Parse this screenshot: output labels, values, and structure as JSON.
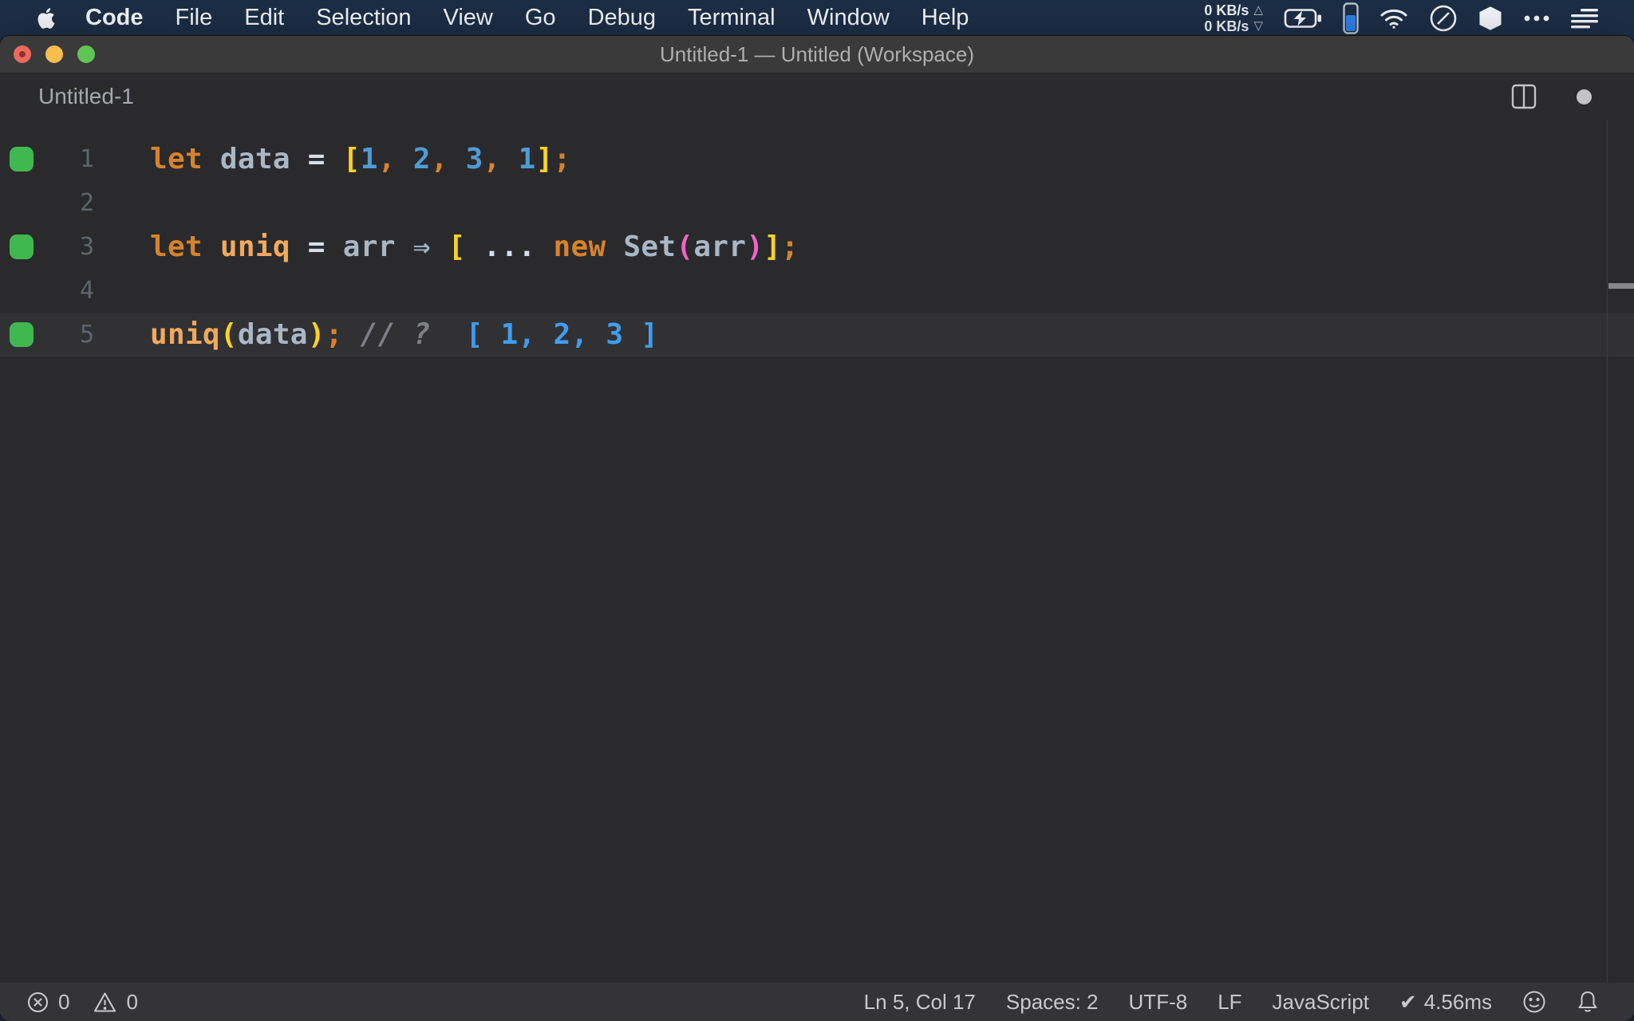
{
  "menubar": {
    "app_menu": "Code",
    "items": [
      "File",
      "Edit",
      "Selection",
      "View",
      "Go",
      "Debug",
      "Terminal",
      "Window",
      "Help"
    ],
    "network": {
      "up": "0 KB/s",
      "down": "0 KB/s"
    }
  },
  "titlebar": {
    "title": "Untitled-1 — Untitled (Workspace)"
  },
  "editor_header": {
    "tab_title": "Untitled-1"
  },
  "editor": {
    "current_line": 5,
    "lines": [
      {
        "num": 1,
        "marker": true,
        "tokens": [
          {
            "t": "let",
            "c": "keyword"
          },
          {
            "t": " ",
            "c": "plain"
          },
          {
            "t": "data",
            "c": "ident"
          },
          {
            "t": " ",
            "c": "plain"
          },
          {
            "t": "=",
            "c": "operator"
          },
          {
            "t": " ",
            "c": "plain"
          },
          {
            "t": "[",
            "c": "bracket1"
          },
          {
            "t": "1",
            "c": "number"
          },
          {
            "t": ",",
            "c": "punct"
          },
          {
            "t": " ",
            "c": "plain"
          },
          {
            "t": "2",
            "c": "number"
          },
          {
            "t": ",",
            "c": "punct"
          },
          {
            "t": " ",
            "c": "plain"
          },
          {
            "t": "3",
            "c": "number"
          },
          {
            "t": ",",
            "c": "punct"
          },
          {
            "t": " ",
            "c": "plain"
          },
          {
            "t": "1",
            "c": "number"
          },
          {
            "t": "]",
            "c": "bracket1"
          },
          {
            "t": ";",
            "c": "punct"
          }
        ]
      },
      {
        "num": 2,
        "marker": false,
        "tokens": []
      },
      {
        "num": 3,
        "marker": true,
        "tokens": [
          {
            "t": "let",
            "c": "keyword"
          },
          {
            "t": " ",
            "c": "plain"
          },
          {
            "t": "uniq",
            "c": "func"
          },
          {
            "t": " ",
            "c": "plain"
          },
          {
            "t": "=",
            "c": "operator"
          },
          {
            "t": " ",
            "c": "plain"
          },
          {
            "t": "arr",
            "c": "ident"
          },
          {
            "t": " ",
            "c": "plain"
          },
          {
            "t": "⇒",
            "c": "arrow"
          },
          {
            "t": " ",
            "c": "plain"
          },
          {
            "t": "[",
            "c": "bracket1"
          },
          {
            "t": " ",
            "c": "plain"
          },
          {
            "t": "... ",
            "c": "operator"
          },
          {
            "t": "new",
            "c": "keyword"
          },
          {
            "t": " ",
            "c": "plain"
          },
          {
            "t": "Set",
            "c": "ident"
          },
          {
            "t": "(",
            "c": "bracket2"
          },
          {
            "t": "arr",
            "c": "ident"
          },
          {
            "t": ")",
            "c": "bracket2"
          },
          {
            "t": "]",
            "c": "bracket1"
          },
          {
            "t": ";",
            "c": "punct"
          }
        ]
      },
      {
        "num": 4,
        "marker": false,
        "tokens": []
      },
      {
        "num": 5,
        "marker": true,
        "tokens": [
          {
            "t": "uniq",
            "c": "func"
          },
          {
            "t": "(",
            "c": "bracket1"
          },
          {
            "t": "data",
            "c": "ident"
          },
          {
            "t": ")",
            "c": "bracket1"
          },
          {
            "t": ";",
            "c": "punct"
          },
          {
            "t": " ",
            "c": "plain"
          },
          {
            "t": "// ?",
            "c": "comment"
          },
          {
            "t": "  ",
            "c": "plain"
          },
          {
            "t": "[ 1, 2, 3 ]",
            "c": "result"
          }
        ]
      }
    ]
  },
  "statusbar": {
    "errors": "0",
    "warnings": "0",
    "cursor": "Ln 5, Col 17",
    "indent": "Spaces: 2",
    "encoding": "UTF-8",
    "eol": "LF",
    "language": "JavaScript",
    "perf": "4.56ms"
  },
  "syntax_colors": {
    "keyword": "#D7832B",
    "func": "#F2A95C",
    "ident": "#A9B7C6",
    "operator": "#D8DEE9",
    "arrow": "#9FB6CC",
    "number": "#4F9CD6",
    "punct": "#D7832B",
    "bracket1": "#FFD21E",
    "bracket2": "#ED64C8",
    "comment": "#7E8085",
    "result": "#3E9EF0",
    "plain": "#C8CDD6"
  },
  "ui_colors": {
    "menubar_bg": "#1C2E46",
    "titlebar_bg": "#3A3A3A",
    "editor_bg": "#2A2A2C",
    "current_line_bg": "#313134",
    "statusbar_bg": "#343438",
    "quokka_marker_green": "#3FB84F"
  }
}
